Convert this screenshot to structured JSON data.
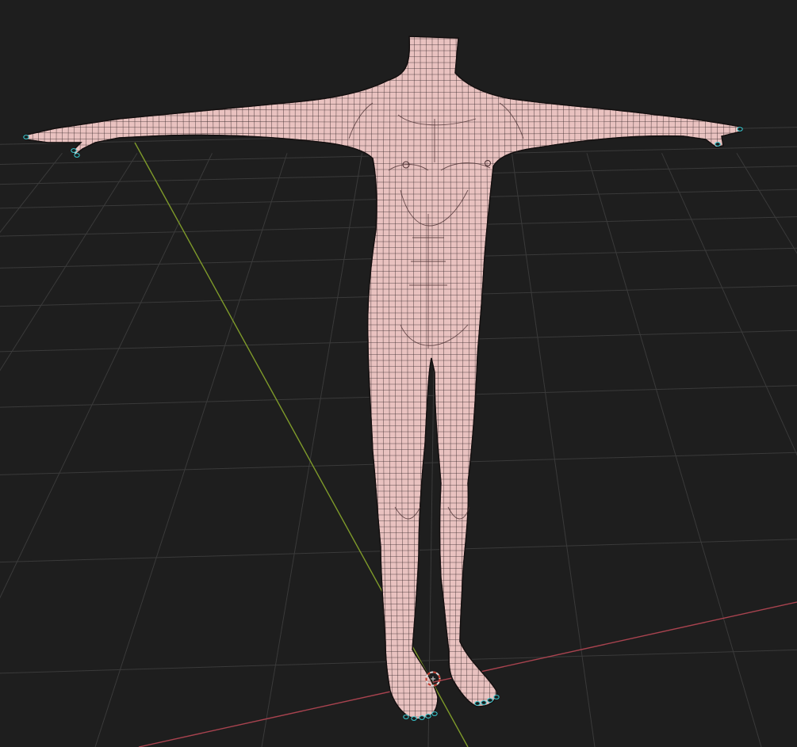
{
  "app": {
    "view": "3d-viewport",
    "shading": "wireframe-overlay-solid"
  },
  "scene": {
    "object": "human-base-mesh",
    "pose": "t-pose",
    "show_floor_grid": true,
    "show_axes": [
      "x",
      "y"
    ],
    "cursor": "3d-cursor"
  },
  "colors": {
    "background": "#1e1e1e",
    "grid": "#3a3a3a",
    "axis_x": "#a8434f",
    "axis_y": "#7e9a2a",
    "skin": "#e9c2c0",
    "wire": "#3a2a2b",
    "selected_vertices": "#3ad0d8",
    "cursor_ring": "#d9d9d9",
    "cursor_dash": "#c0392b"
  }
}
